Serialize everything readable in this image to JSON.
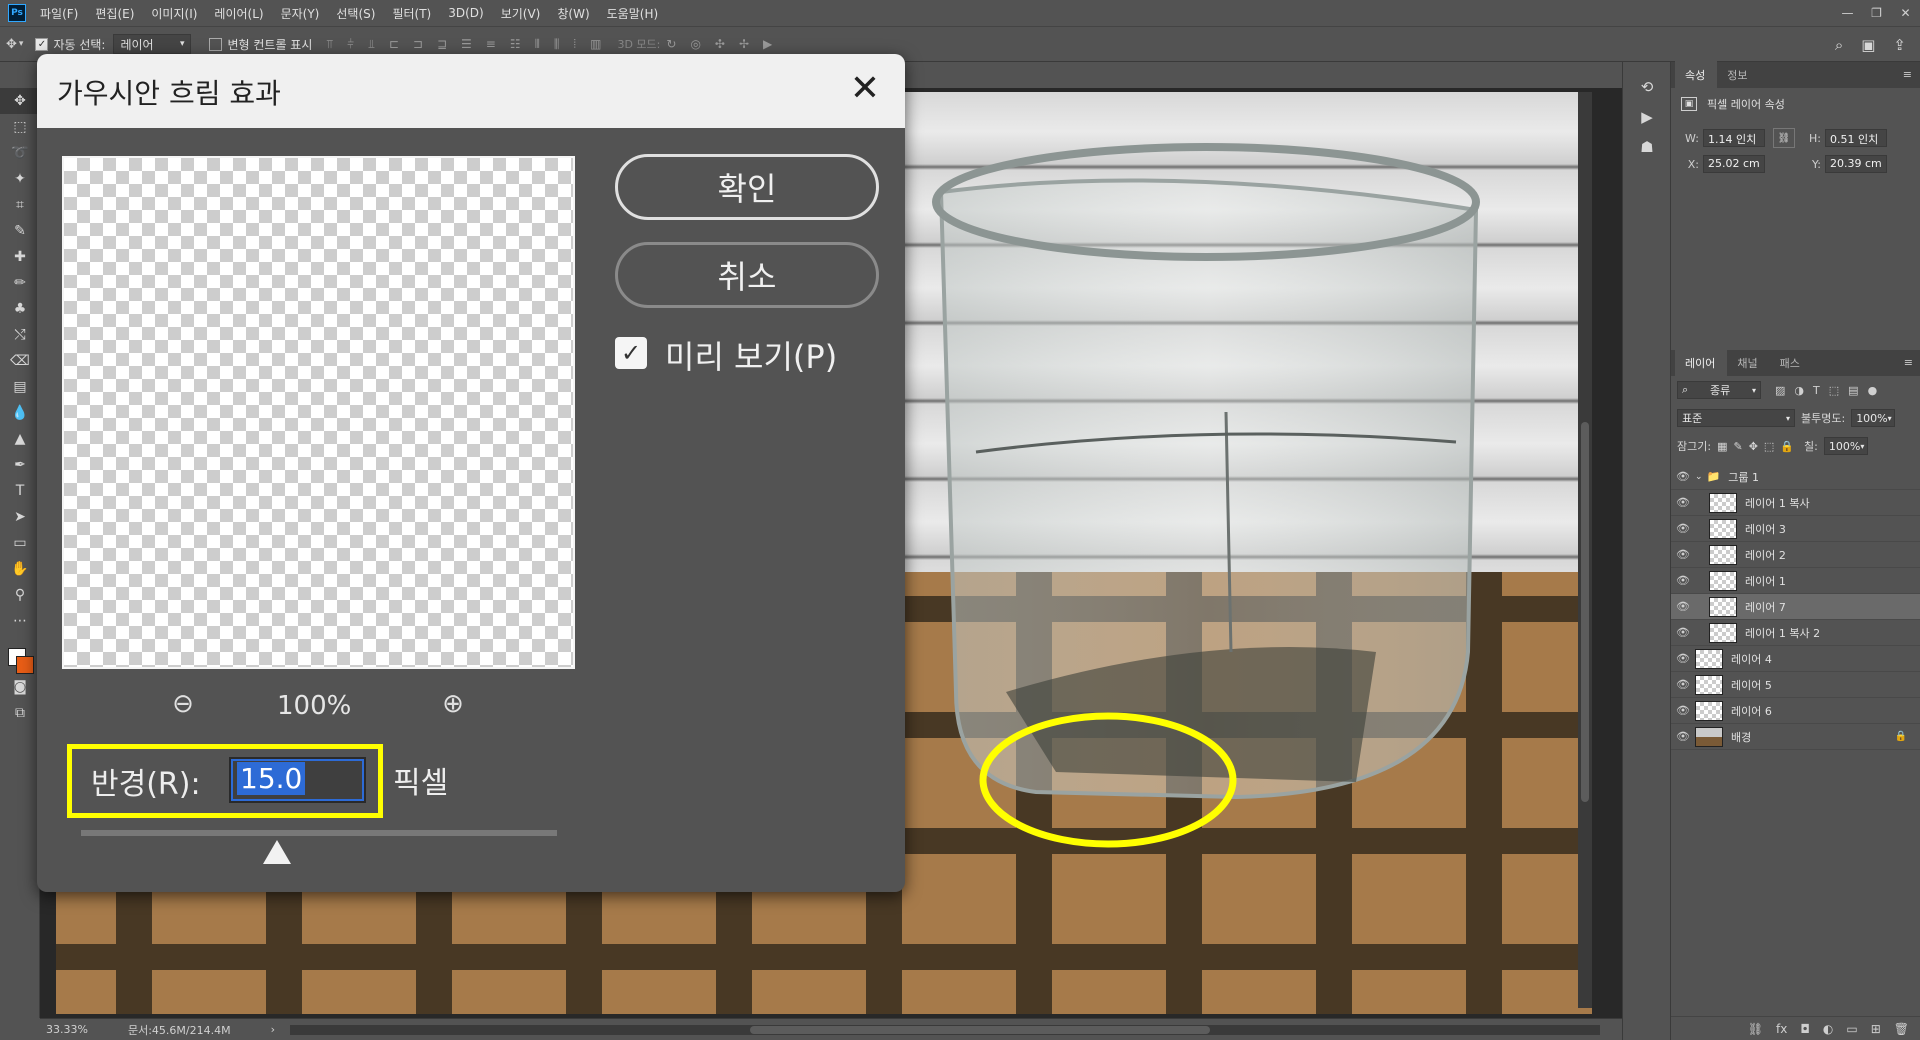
{
  "app": {
    "logo": "Ps"
  },
  "menu": [
    "파일(F)",
    "편집(E)",
    "이미지(I)",
    "레이어(L)",
    "문자(Y)",
    "선택(S)",
    "필터(T)",
    "3D(D)",
    "보기(V)",
    "창(W)",
    "도움말(H)"
  ],
  "window_controls": {
    "minimize": "—",
    "restore": "❐",
    "close": "✕"
  },
  "options": {
    "auto_select_label": "자동 선택:",
    "auto_select_value": "레이어",
    "transform_label": "변형 컨트롤 표시",
    "mode3d_label": "3D 모드:"
  },
  "status": {
    "zoom": "33.33%",
    "doc": "문서:45.6M/214.4M"
  },
  "properties": {
    "tabs": [
      "속성",
      "정보"
    ],
    "title": "픽셀 레이어 속성",
    "w_label": "W:",
    "w": "1.14 인치",
    "h_label": "H:",
    "h": "0.51 인치",
    "x_label": "X:",
    "x": "25.02 cm",
    "y_label": "Y:",
    "y": "20.39 cm"
  },
  "layers_panel": {
    "tabs": [
      "레이어",
      "채널",
      "패스"
    ],
    "filter_label": "종류",
    "blend_mode": "표준",
    "opacity_label": "불투명도:",
    "opacity": "100%",
    "lock_label": "잠그기:",
    "fill_label": "칠:",
    "fill": "100%",
    "layers": [
      {
        "name": "그룹 1",
        "type": "group"
      },
      {
        "name": "레이어 1 복사",
        "type": "layer",
        "indent": true
      },
      {
        "name": "레이어 3",
        "type": "layer",
        "indent": true
      },
      {
        "name": "레이어 2",
        "type": "layer",
        "indent": true
      },
      {
        "name": "레이어 1",
        "type": "layer",
        "indent": true
      },
      {
        "name": "레이어 7",
        "type": "layer",
        "indent": true,
        "selected": true
      },
      {
        "name": "레이어 1 복사 2",
        "type": "layer",
        "indent": true
      },
      {
        "name": "레이어 4",
        "type": "layer"
      },
      {
        "name": "레이어 5",
        "type": "layer"
      },
      {
        "name": "레이어 6",
        "type": "layer"
      },
      {
        "name": "배경",
        "type": "background",
        "locked": true
      }
    ]
  },
  "dialog": {
    "title": "가우시안 흐림 효과",
    "ok": "확인",
    "cancel": "취소",
    "preview_label": "미리 보기(P)",
    "preview_checked": true,
    "zoom": "100%",
    "radius_label": "반경(R):",
    "radius_value": "15.0",
    "radius_unit": "픽셀"
  },
  "colors": {
    "highlight": "#ffff00",
    "selection": "#2d6bd6",
    "foreground": "#ffffff",
    "background": "#e85d16"
  }
}
